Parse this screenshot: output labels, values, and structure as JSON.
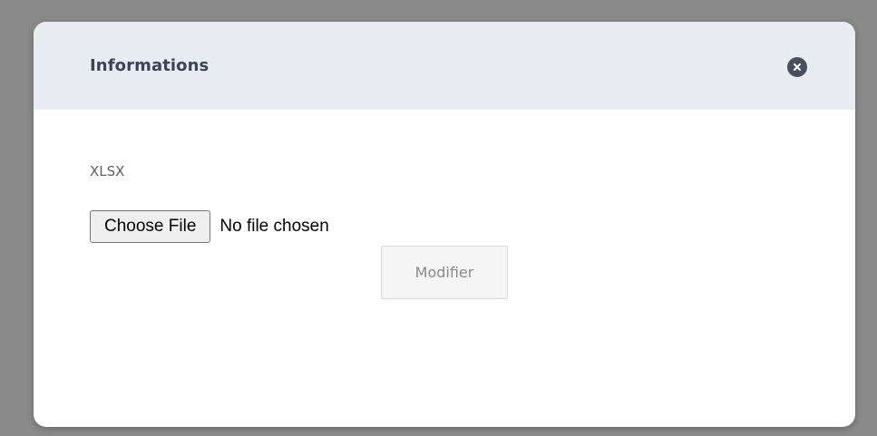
{
  "modal": {
    "title": "Informations",
    "close_icon": "close-icon",
    "field_label": "XLSX",
    "file_input": {
      "button_label": "Choose File",
      "status_text": "No file chosen"
    },
    "submit_label": "Modifier"
  },
  "colors": {
    "overlay": "#7f7f7f",
    "header_bg": "#e9edf3",
    "title_text": "#3c4257",
    "close_button_bg": "#4a4f60"
  }
}
